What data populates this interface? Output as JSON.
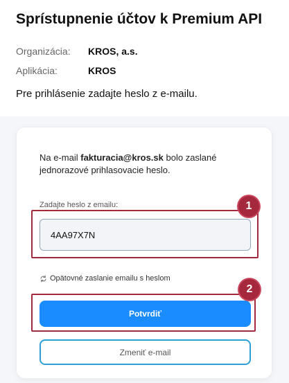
{
  "header": {
    "title": "Sprístupnenie účtov k Premium API"
  },
  "meta": {
    "organization_label": "Organizácia:",
    "organization_value": "KROS, a.s.",
    "application_label": "Aplikácia:",
    "application_value": "KROS"
  },
  "instruction": "Pre prihlásenie zadajte heslo z e-mailu.",
  "card": {
    "info_prefix": "Na e-mail ",
    "info_email": "fakturacia@kros.sk",
    "info_suffix": " bolo zaslané jednorazové prihlasovacie heslo.",
    "password_label": "Zadajte heslo z emailu:",
    "password_value": "4AA97X7N",
    "resend_label": "Opätovné zaslanie emailu s heslom",
    "confirm_label": "Potvrdiť",
    "change_email_label": "Zmeniť e-mail"
  },
  "annotations": {
    "marker_1": "1",
    "marker_2": "2",
    "color": "#a5283d"
  },
  "colors": {
    "primary_button": "#1a8cff",
    "secondary_border": "#2b9fd6"
  },
  "icons": {
    "resend": "refresh-icon"
  }
}
